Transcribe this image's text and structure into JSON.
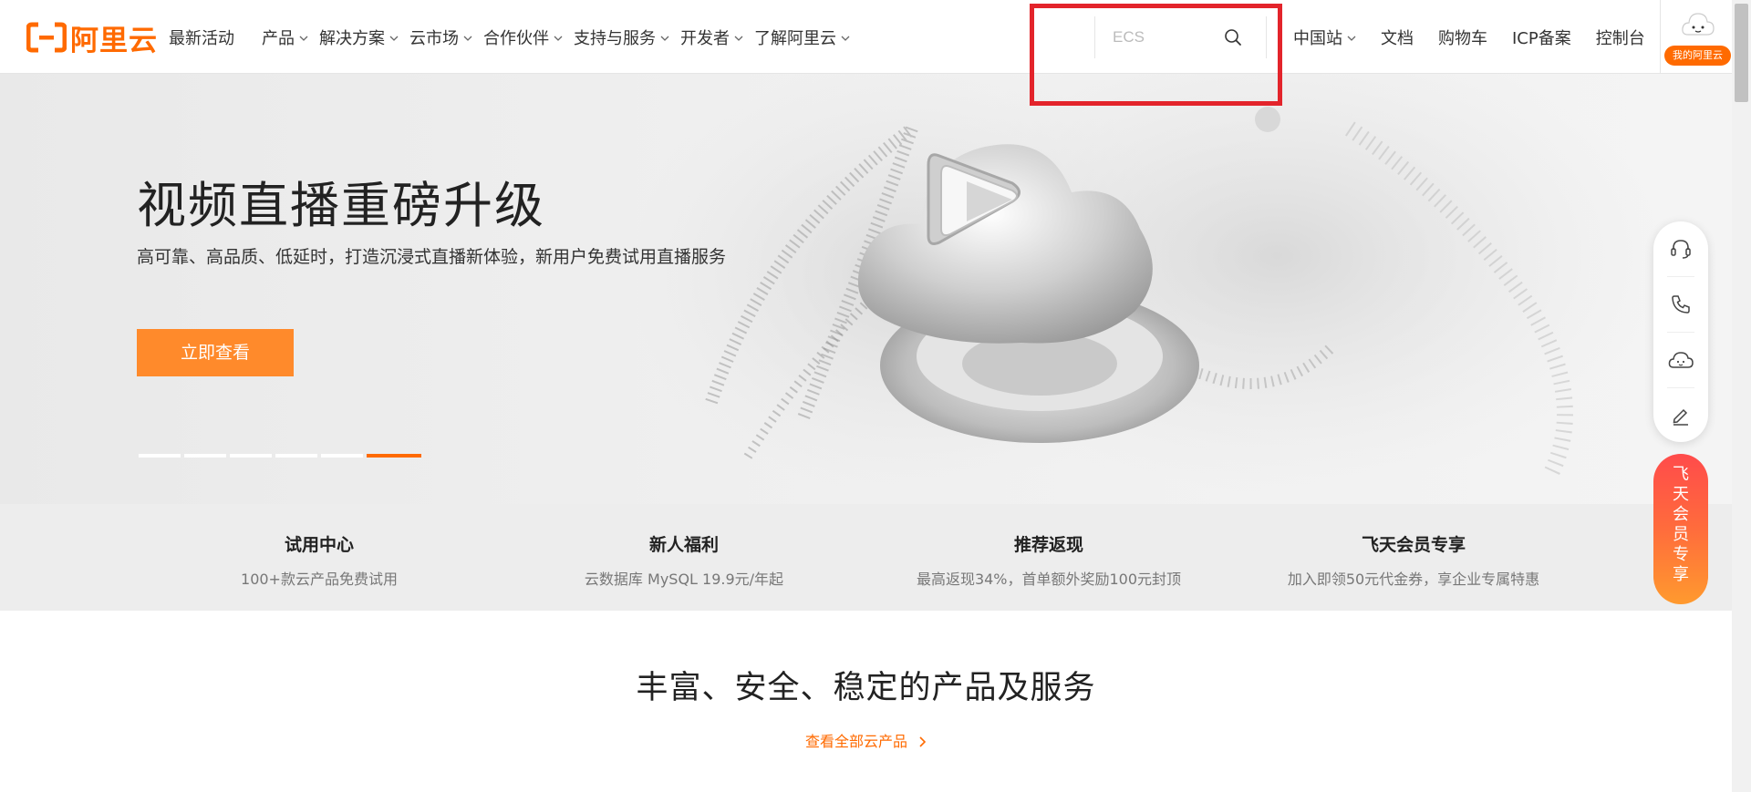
{
  "brand": {
    "name": "阿里云",
    "color": "#ff6a00"
  },
  "nav": {
    "items": [
      {
        "label": "最新活动",
        "dropdown": false
      },
      {
        "label": "产品",
        "dropdown": true
      },
      {
        "label": "解决方案",
        "dropdown": true
      },
      {
        "label": "云市场",
        "dropdown": true
      },
      {
        "label": "合作伙伴",
        "dropdown": true
      },
      {
        "label": "支持与服务",
        "dropdown": true
      },
      {
        "label": "开发者",
        "dropdown": true
      },
      {
        "label": "了解阿里云",
        "dropdown": true
      }
    ]
  },
  "search": {
    "placeholder": "ECS",
    "icon": "search-icon"
  },
  "right_nav": {
    "region": "中国站",
    "docs": "文档",
    "cart": "购物车",
    "icp": "ICP备案",
    "console": "控制台"
  },
  "user": {
    "my_aliyun": "我的阿里云"
  },
  "hero": {
    "title": "视频直播重磅升级",
    "subtitle": "高可靠、高品质、低延时，打造沉浸式直播新体验，新用户免费试用直播服务",
    "cta": "立即查看",
    "slide_count": 6,
    "active_slide": 6
  },
  "promos": [
    {
      "title": "试用中心",
      "desc": "100+款云产品免费试用"
    },
    {
      "title": "新人福利",
      "desc": "云数据库 MySQL 19.9元/年起"
    },
    {
      "title": "推荐返现",
      "desc": "最高返现34%，首单额外奖励100元封顶"
    },
    {
      "title": "飞天会员专享",
      "desc": "加入即领50元代金券，享企业专属特惠"
    }
  ],
  "section": {
    "title": "丰富、安全、稳定的产品及服务",
    "link": "查看全部云产品"
  },
  "float_tools": [
    "headset-icon",
    "phone-icon",
    "cloud-face-icon",
    "edit-icon"
  ],
  "member_tab": {
    "label": "飞天会员专享"
  },
  "colors": {
    "accent": "#ff6a00",
    "cta": "#ff8a2b",
    "highlight_box": "#e3242b"
  }
}
